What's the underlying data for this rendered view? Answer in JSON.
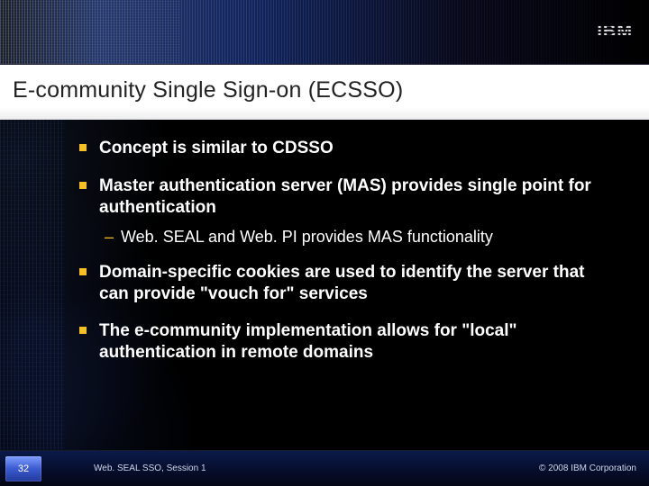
{
  "header": {
    "logo_text": "IBM"
  },
  "title": "E-community Single Sign-on (ECSSO)",
  "bullets": [
    {
      "text": "Concept is similar to CDSSO"
    },
    {
      "text": "Master authentication server (MAS) provides single point for authentication",
      "sub": "Web. SEAL and Web. PI provides MAS functionality"
    },
    {
      "text": "Domain-specific cookies are used to identify the server that can provide \"vouch for\" services"
    },
    {
      "text": "The e-community implementation allows for \"local\" authentication in remote domains"
    }
  ],
  "footer": {
    "page_number": "32",
    "session": "Web. SEAL SSO, Session 1",
    "copyright": "© 2008 IBM Corporation"
  },
  "colors": {
    "bullet_marker": "#f5c020",
    "footer_bg": "#0a1a4a",
    "accent_blue": "#3a5ad0"
  }
}
